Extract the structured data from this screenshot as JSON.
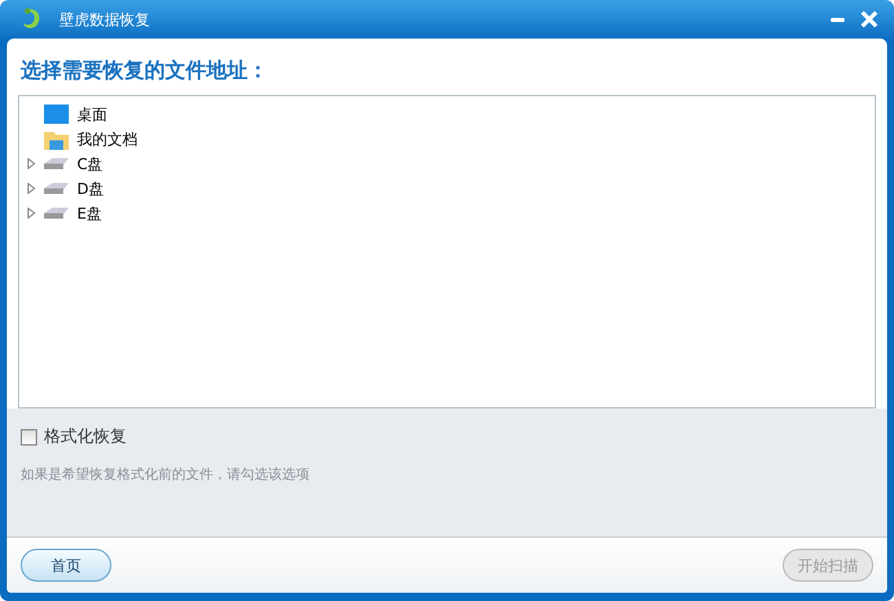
{
  "window": {
    "title": "壁虎数据恢复"
  },
  "heading": "选择需要恢复的文件地址：",
  "tree": [
    {
      "label": "桌面",
      "kind": "desktop",
      "expandable": false
    },
    {
      "label": "我的文档",
      "kind": "documents",
      "expandable": false
    },
    {
      "label": "C盘",
      "kind": "drive",
      "expandable": true
    },
    {
      "label": "D盘",
      "kind": "drive",
      "expandable": true
    },
    {
      "label": "E盘",
      "kind": "drive",
      "expandable": true
    }
  ],
  "format_option": {
    "label": "格式化恢复",
    "checked": false
  },
  "hint": "如果是希望恢复格式化前的文件，请勾选该选项",
  "buttons": [
    {
      "label": "首页",
      "disabled": false
    },
    {
      "label": "开始扫描",
      "disabled": true
    }
  ]
}
